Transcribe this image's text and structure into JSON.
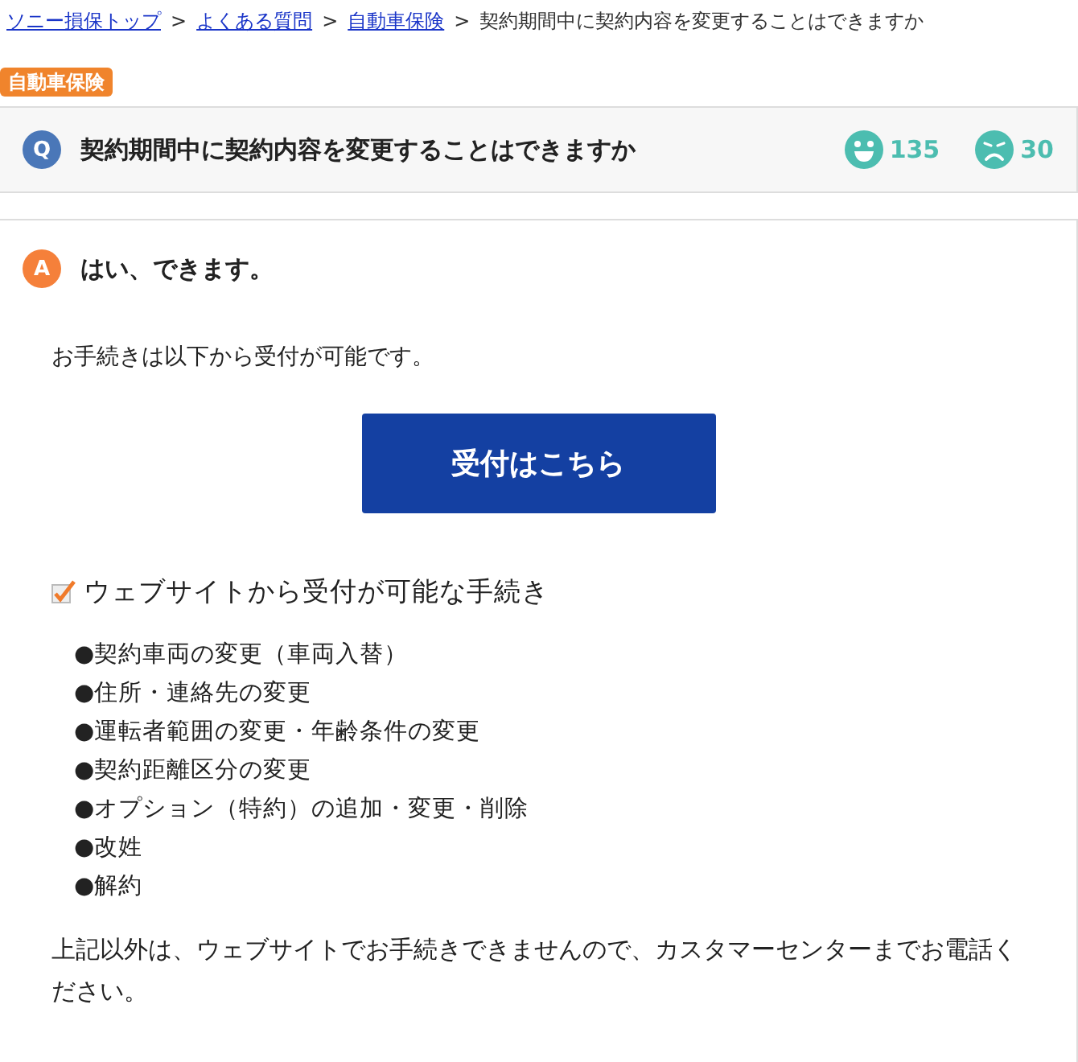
{
  "breadcrumb": [
    {
      "label": "ソニー損保トップ",
      "link": true
    },
    {
      "label": "よくある質問",
      "link": true
    },
    {
      "label": "自動車保険",
      "link": true
    },
    {
      "label": "契約期間中に契約内容を変更することはできますか",
      "link": false
    }
  ],
  "separator": ">",
  "category_tag": "自動車保険",
  "question": {
    "badge": "Q",
    "text": "契約期間中に契約内容を変更することはできますか",
    "helpful_count": "135",
    "unhelpful_count": "30"
  },
  "answer": {
    "badge": "A",
    "headline": "はい、できます。",
    "intro": "お手続きは以下から受付が可能です。",
    "button": "受付はこちら",
    "section_title": "ウェブサイトから受付が可能な手続き",
    "items": [
      "●契約車両の変更（車両入替）",
      "●住所・連絡先の変更",
      "●運転者範囲の変更・年齢条件の変更",
      "●契約距離区分の変更",
      "●オプション（特約）の追加・変更・削除",
      "●改姓",
      "●解約"
    ],
    "note": "上記以外は、ウェブサイトでお手続きできませんので、カスタマーセンターまでお電話ください。"
  }
}
